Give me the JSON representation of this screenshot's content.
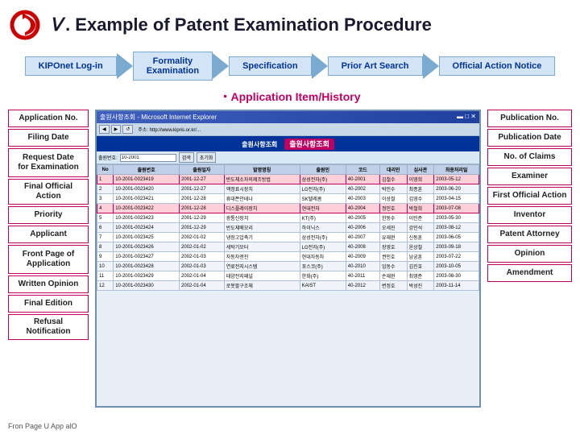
{
  "header": {
    "roman_numeral": "Ⅴ",
    "title": ". Example of Patent Examination Procedure"
  },
  "process_steps": [
    {
      "id": "kiponet",
      "label": "KIPOnet Log-in",
      "active": false
    },
    {
      "id": "formality",
      "label": "Formality\nExamination",
      "active": false
    },
    {
      "id": "specification",
      "label": "Specification",
      "active": false
    },
    {
      "id": "prior_art",
      "label": "Prior Art Search",
      "active": false
    },
    {
      "id": "official_action",
      "label": "Official Action Notice",
      "active": false
    }
  ],
  "section_title": "・Application Item/History",
  "left_labels": [
    {
      "id": "application_no",
      "text": "Application No."
    },
    {
      "id": "filing_date",
      "text": "Filing Date"
    },
    {
      "id": "request_date",
      "text": "Request Date\nfor Examination"
    },
    {
      "id": "final_official",
      "text": "Final Official Action"
    },
    {
      "id": "priority",
      "text": "Priority"
    },
    {
      "id": "applicant",
      "text": "Applicant"
    },
    {
      "id": "front_page",
      "text": "Front Page of\nApplication"
    },
    {
      "id": "written_opinion",
      "text": "Written Opinion"
    },
    {
      "id": "final_edition",
      "text": "Final Edition"
    },
    {
      "id": "refusal",
      "text": "Refusal Notification"
    }
  ],
  "right_labels": [
    {
      "id": "publication_no",
      "text": "Publication No."
    },
    {
      "id": "publication_date",
      "text": "Publication Date"
    },
    {
      "id": "no_of_claims",
      "text": "No. of Claims"
    },
    {
      "id": "examiner",
      "text": "Examiner"
    },
    {
      "id": "first_official",
      "text": "First Official Action"
    },
    {
      "id": "inventor",
      "text": "Inventor"
    },
    {
      "id": "patent_attorney",
      "text": "Patent Attorney"
    },
    {
      "id": "opinion",
      "text": "Opinion"
    },
    {
      "id": "amendment",
      "text": "Amendment"
    }
  ],
  "screenshot": {
    "titlebar": "출원사항조회 - Microsoft Internet Explorer",
    "header_text": "출원사항조회",
    "columns": [
      "출원번호",
      "출원일자",
      "발명명칭",
      "출원인",
      "출원인코드",
      "대리인",
      "심사관",
      "최종처리일"
    ],
    "rows": [
      {
        "highlighted": true,
        "cells": [
          "10-2001-0023419",
          "2001-12-27",
          "반도체소자의제조방법",
          "삼성전자(주)",
          "40-2001",
          "김철수",
          "이영희",
          "2003-05-12"
        ]
      },
      {
        "highlighted": false,
        "cells": [
          "10-2001-0023420",
          "2001-12-27",
          "액정표시장치",
          "LG전자(주)",
          "40-2002",
          "박민수",
          "최종훈",
          "2003-06-20"
        ]
      },
      {
        "highlighted": false,
        "cells": [
          "10-2001-0023421",
          "2001-12-28",
          "휴대폰안테나",
          "SK텔레콤",
          "40-2003",
          "이상철",
          "김영수",
          "2003-04-15"
        ]
      },
      {
        "highlighted": true,
        "cells": [
          "10-2001-0023422",
          "2001-12-28",
          "디스플레이장치",
          "현대전자",
          "40-2004",
          "정민호",
          "박철희",
          "2003-07-08"
        ]
      },
      {
        "highlighted": false,
        "cells": [
          "10-2001-0023423",
          "2001-12-29",
          "광통신장치",
          "KT(주)",
          "40-2005",
          "한동수",
          "이민준",
          "2003-05-30"
        ]
      },
      {
        "highlighted": false,
        "cells": [
          "10-2001-0023424",
          "2001-12-29",
          "반도체메모리",
          "하이닉스",
          "40-2006",
          "오세진",
          "강민석",
          "2003-08-12"
        ]
      },
      {
        "highlighted": false,
        "cells": [
          "10-2001-0023425",
          "2002-01-02",
          "냉장고압축기",
          "삼성전자(주)",
          "40-2007",
          "유재현",
          "신동훈",
          "2003-06-05"
        ]
      },
      {
        "highlighted": false,
        "cells": [
          "10-2001-0023426",
          "2002-01-02",
          "세탁기모터",
          "LG전자(주)",
          "40-2008",
          "장영호",
          "윤상철",
          "2003-09-18"
        ]
      },
      {
        "highlighted": false,
        "cells": [
          "10-2001-0023427",
          "2002-01-03",
          "자동차엔진",
          "현대자동차",
          "40-2009",
          "권민호",
          "남궁훈",
          "2003-07-22"
        ]
      },
      {
        "highlighted": false,
        "cells": [
          "10-2001-0023428",
          "2002-01-03",
          "연료전지시스템",
          "포스코(주)",
          "40-2010",
          "임동수",
          "김진호",
          "2003-10-05"
        ]
      },
      {
        "highlighted": false,
        "cells": [
          "10-2001-0023429",
          "2002-01-04",
          "태양전지패널",
          "한화(주)",
          "40-2011",
          "손재현",
          "최영준",
          "2003-08-30"
        ]
      },
      {
        "highlighted": false,
        "cells": [
          "10-2001-0023430",
          "2002-01-04",
          "로봇팔구조체",
          "KAIST",
          "40-2012",
          "변정호",
          "박성진",
          "2003-11-14"
        ]
      }
    ]
  },
  "bottom_text": "Fron Page U App alO"
}
